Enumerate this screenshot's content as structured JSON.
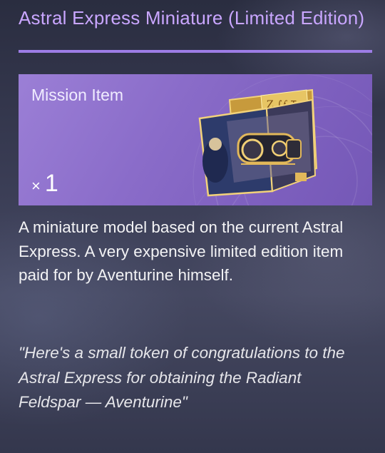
{
  "item": {
    "title": "Astral Express Miniature (Limited Edition)",
    "type_label": "Mission Item",
    "quantity_prefix": "×",
    "quantity": "1",
    "image_icon": "astral-express-miniature-box-icon",
    "description": "A miniature model based on the current Astral Express. A very expensive limited edition item paid for by Aventurine himself.",
    "quote": "\"Here's a small token of congratulations to the Astral Express for obtaining the Radiant Feldspar — Aventurine\""
  },
  "colors": {
    "title": "#c9a6ff",
    "title_rule": "#9d7de6",
    "card": "#8a6cc9",
    "body_text": "#f3f3f5"
  }
}
